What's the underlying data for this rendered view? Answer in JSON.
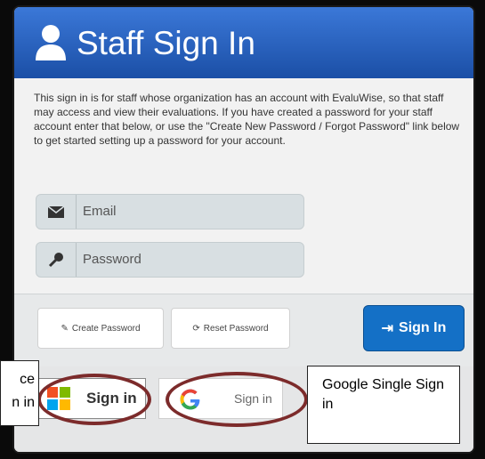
{
  "header": {
    "title": "Staff Sign In",
    "icon": "user-icon"
  },
  "intro_text": "This sign in is for staff whose organization has an account with EvaluWise, so that staff may access and view their evaluations. If you have created a password for your staff account enter that below, or use the \"Create New Password / Forgot Password\" link below to get started setting up a password for your account.",
  "form": {
    "email_placeholder": "Email",
    "password_placeholder": "Password"
  },
  "actions": {
    "create_password": "Create Password",
    "reset_password": "Reset Password",
    "sign_in": "Sign In"
  },
  "sso": {
    "microsoft_label": "Sign in",
    "google_label": "Sign in"
  },
  "annotations": {
    "left_line1": "ce",
    "left_line2": "n in",
    "right": "Google Single Sign in"
  },
  "colors": {
    "header_blue": "#2563c4",
    "primary_button": "#1470c6",
    "annotation_oval": "#7c2b2b"
  }
}
